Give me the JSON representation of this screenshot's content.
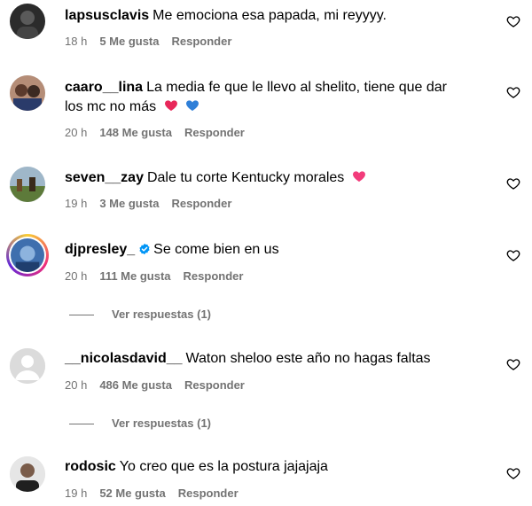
{
  "comments": [
    {
      "username": "lapsusclavis",
      "text": "Me emociona esa papada, mi reyyyy.",
      "time": "18 h",
      "likes": "5 Me gusta",
      "reply": "Responder"
    },
    {
      "username": "caaro__lina",
      "text_line1": "La media fe que le llevo al shelito, tiene que dar",
      "text_line2": "los mc no más",
      "time": "20 h",
      "likes": "148 Me gusta",
      "reply": "Responder"
    },
    {
      "username": "seven__zay",
      "text": "Dale tu corte Kentucky morales",
      "time": "19 h",
      "likes": "3 Me gusta",
      "reply": "Responder"
    },
    {
      "username": "djpresley_",
      "text": "Se come bien en us",
      "time": "20 h",
      "likes": "111 Me gusta",
      "reply": "Responder",
      "view_replies": "Ver respuestas (1)"
    },
    {
      "username": "__nicolasdavid__",
      "text": "Waton sheloo este año no hagas faltas",
      "time": "20 h",
      "likes": "486 Me gusta",
      "reply": "Responder",
      "view_replies": "Ver respuestas (1)"
    },
    {
      "username": "rodosic",
      "text": "Yo creo que es la postura jajajaja",
      "time": "19 h",
      "likes": "52 Me gusta",
      "reply": "Responder"
    }
  ],
  "icons": {
    "like": "heart-outline-icon",
    "verified": "verified-badge-icon",
    "emoji_red": "red-heart-emoji",
    "emoji_blue": "blue-heart-emoji",
    "emoji_pink": "pink-heart-emoji"
  },
  "colors": {
    "meta": "#737373",
    "verified": "#0095f6",
    "heart_red": "#e8285a",
    "heart_blue": "#2f7fd8",
    "heart_pink": "#f23c7b"
  }
}
